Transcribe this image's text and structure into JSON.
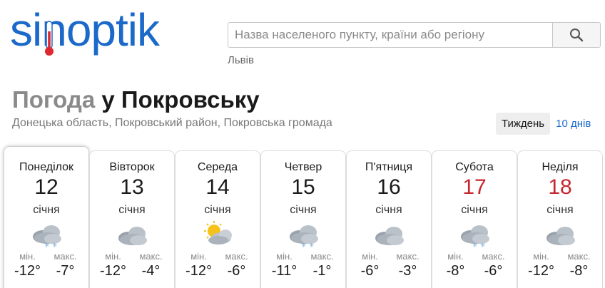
{
  "logo": {
    "text": "sinoptik"
  },
  "search": {
    "placeholder": "Назва населеного пункту, країни або регіону",
    "recent": "Львів",
    "icon": "search-icon"
  },
  "title": {
    "prefix": "Погода",
    "location": "у Покровську"
  },
  "region": "Донецька область, Покровський район, Покровська громада",
  "tabs": {
    "week": "Тиждень",
    "ten_days": "10 днів"
  },
  "labels": {
    "min": "мін.",
    "max": "макс."
  },
  "colors": {
    "brand": "#1b6ac9",
    "weekend": "#c6262e"
  },
  "days": [
    {
      "name": "Понеділок",
      "num": "12",
      "month": "січня",
      "icon": "cloudy-snow-icon",
      "min": "-12°",
      "max": "-7°",
      "weekend": false,
      "active": true
    },
    {
      "name": "Вівторок",
      "num": "13",
      "month": "січня",
      "icon": "overcast-icon",
      "min": "-12°",
      "max": "-4°",
      "weekend": false,
      "active": false
    },
    {
      "name": "Середа",
      "num": "14",
      "month": "січня",
      "icon": "partly-cloudy-icon",
      "min": "-12°",
      "max": "-6°",
      "weekend": false,
      "active": false
    },
    {
      "name": "Четвер",
      "num": "15",
      "month": "січня",
      "icon": "cloudy-snow-icon",
      "min": "-11°",
      "max": "-1°",
      "weekend": false,
      "active": false
    },
    {
      "name": "П'ятниця",
      "num": "16",
      "month": "січня",
      "icon": "overcast-icon",
      "min": "-6°",
      "max": "-3°",
      "weekend": false,
      "active": false
    },
    {
      "name": "Субота",
      "num": "17",
      "month": "січня",
      "icon": "cloudy-snow-icon",
      "min": "-8°",
      "max": "-6°",
      "weekend": true,
      "active": false
    },
    {
      "name": "Неділя",
      "num": "18",
      "month": "січня",
      "icon": "overcast-icon",
      "min": "-12°",
      "max": "-8°",
      "weekend": true,
      "active": false
    }
  ]
}
